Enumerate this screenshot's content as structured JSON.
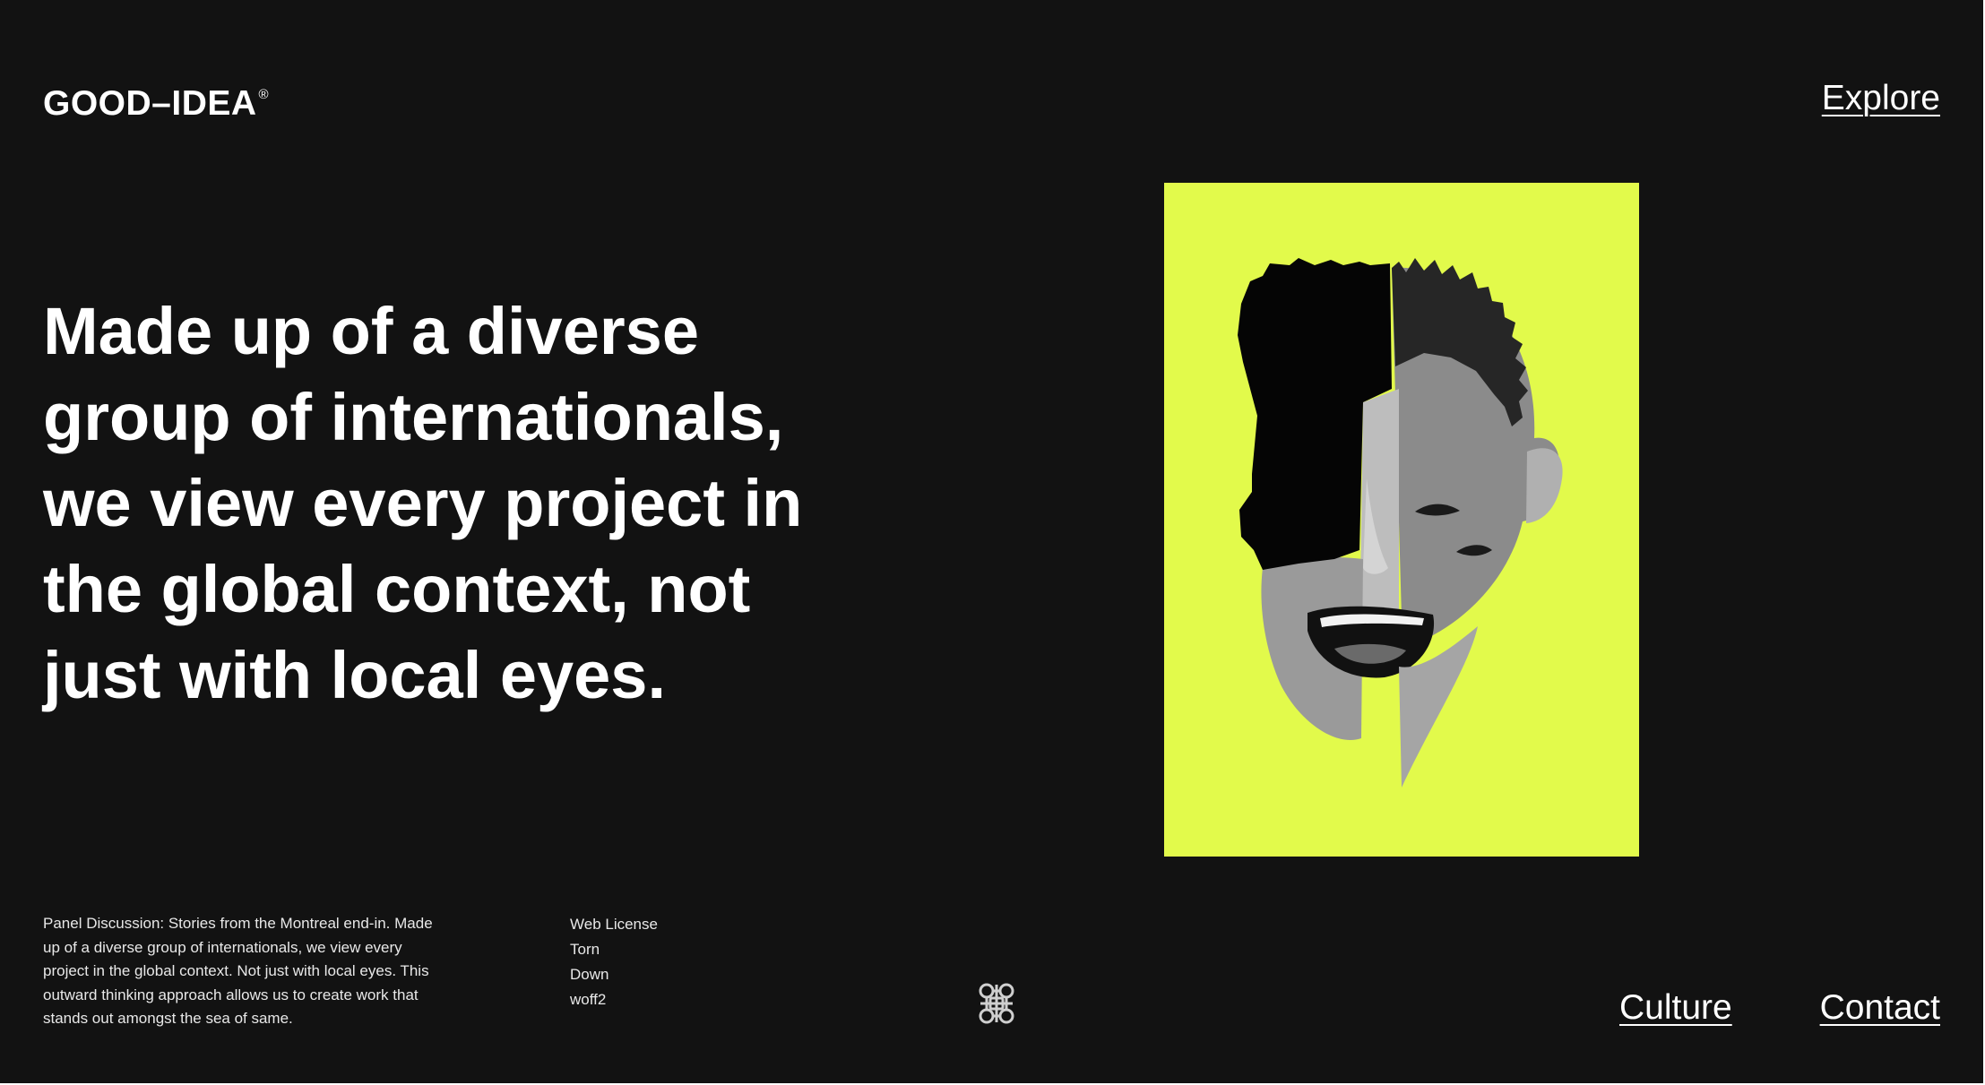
{
  "brand": {
    "name": "GOOD–IDEA",
    "mark": "®"
  },
  "nav": {
    "explore": "Explore",
    "culture": "Culture",
    "contact": "Contact"
  },
  "hero": {
    "headline_lines": [
      "Made up of a diverse",
      "group of internationals,",
      "we view every project in",
      "the global context, not",
      "just with local eyes."
    ]
  },
  "poster": {
    "background_color": "#e2fa4b",
    "image_icon": "split-face-collage-image"
  },
  "footer": {
    "blurb_lines": [
      "Panel Discussion: Stories from the Montreal end-in. Made",
      "up of a diverse group of internationals, we view every",
      "project in the global context.  Not just with local eyes. This",
      "outward thinking approach allows us to create work that",
      "stands out amongst the sea of same."
    ],
    "meta_items": [
      "Web License",
      "Torn",
      "Down",
      "woff2"
    ],
    "center_icon": "celtic-knot-icon"
  },
  "colors": {
    "background": "#121212",
    "text": "#ffffff",
    "accent": "#e2fa4b"
  }
}
